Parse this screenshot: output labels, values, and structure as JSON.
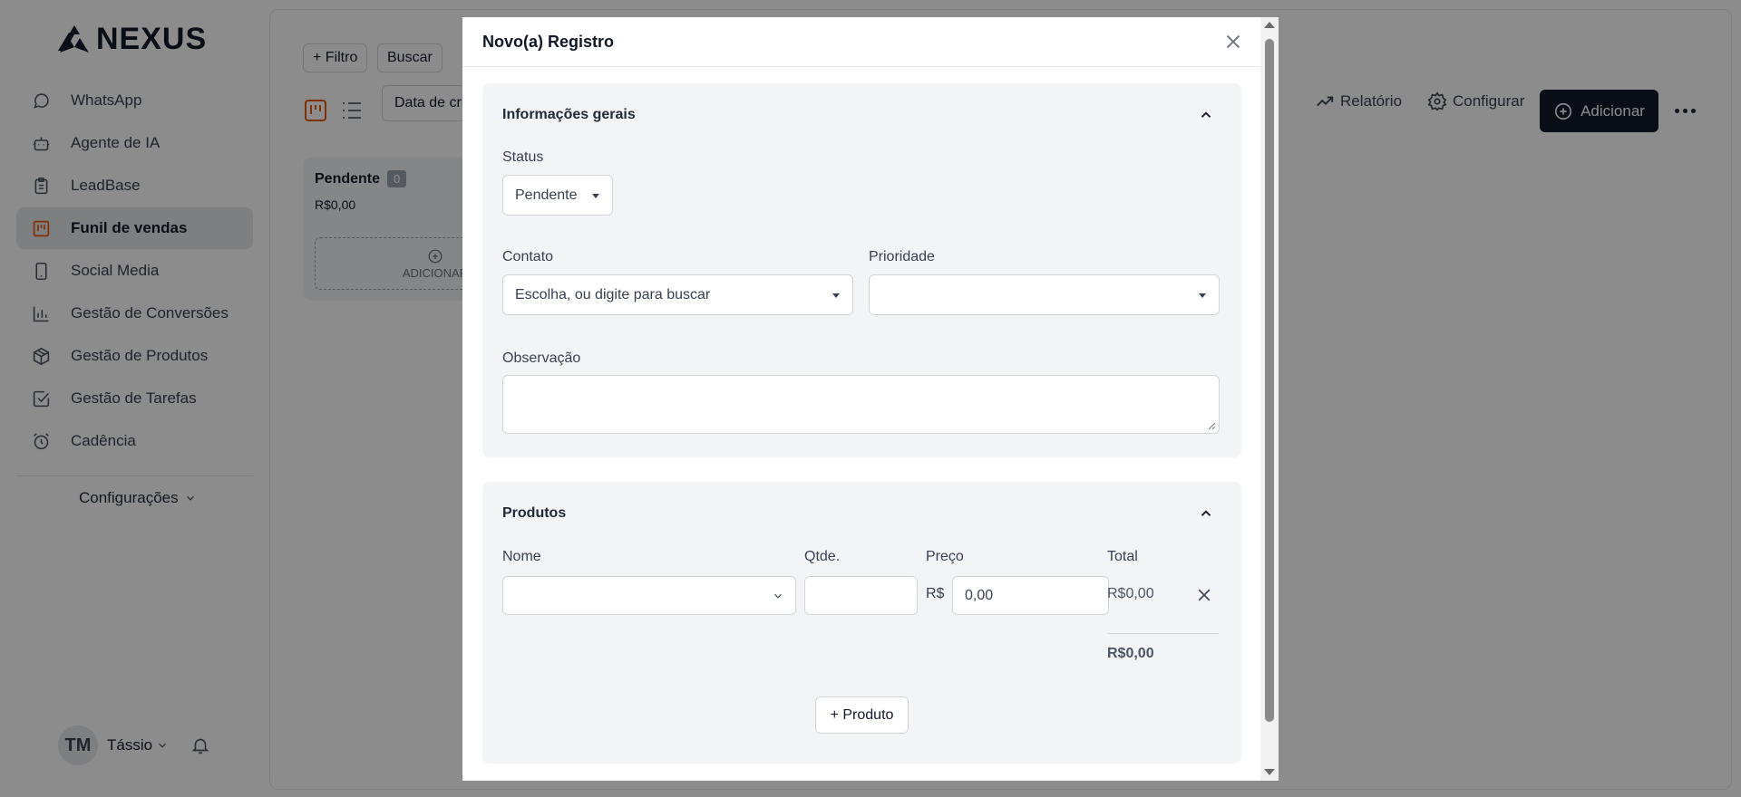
{
  "brand": {
    "name": "NEXUS"
  },
  "sidebar": {
    "items": [
      {
        "label": "WhatsApp",
        "icon": "chat-bubble-icon"
      },
      {
        "label": "Agente de IA",
        "icon": "robot-icon"
      },
      {
        "label": "LeadBase",
        "icon": "clipboard-icon"
      },
      {
        "label": "Funil de vendas",
        "icon": "kanban-icon",
        "active": true
      },
      {
        "label": "Social Media",
        "icon": "smartphone-icon"
      },
      {
        "label": "Gestão de Conversões",
        "icon": "bar-chart-icon"
      },
      {
        "label": "Gestão de Produtos",
        "icon": "package-icon"
      },
      {
        "label": "Gestão de Tarefas",
        "icon": "checkbox-icon"
      },
      {
        "label": "Cadência",
        "icon": "alarm-clock-icon"
      }
    ],
    "settings_label": "Configurações",
    "user": {
      "initials": "TM",
      "name": "Tássio"
    }
  },
  "toolbar": {
    "filter_label": "+ Filtro",
    "search_label": "Buscar",
    "date_select_value": "Data de criação",
    "report_label": "Relatório",
    "configure_label": "Configurar",
    "add_label": "Adicionar"
  },
  "board": {
    "column": {
      "title": "Pendente",
      "count": "0",
      "total": "R$0,00",
      "add_label": "ADICIONAR"
    }
  },
  "modal": {
    "title": "Novo(a) Registro",
    "general": {
      "title": "Informações gerais",
      "status_label": "Status",
      "status_value": "Pendente",
      "contact_label": "Contato",
      "contact_placeholder": "Escolha, ou digite para buscar",
      "priority_label": "Prioridade",
      "priority_value": "",
      "note_label": "Observação",
      "note_value": ""
    },
    "products": {
      "title": "Produtos",
      "headers": {
        "name": "Nome",
        "qty": "Qtde.",
        "price": "Preço",
        "total": "Total"
      },
      "row": {
        "name": "",
        "qty": "",
        "currency": "R$",
        "price": "0,00",
        "total": "R$0,00"
      },
      "grand_total": "R$0,00",
      "add_label": "+ Produto"
    }
  },
  "colors": {
    "accent": "#ea580c",
    "primary_button": "#111827",
    "overlay": "rgba(0,0,0,0.45)"
  }
}
